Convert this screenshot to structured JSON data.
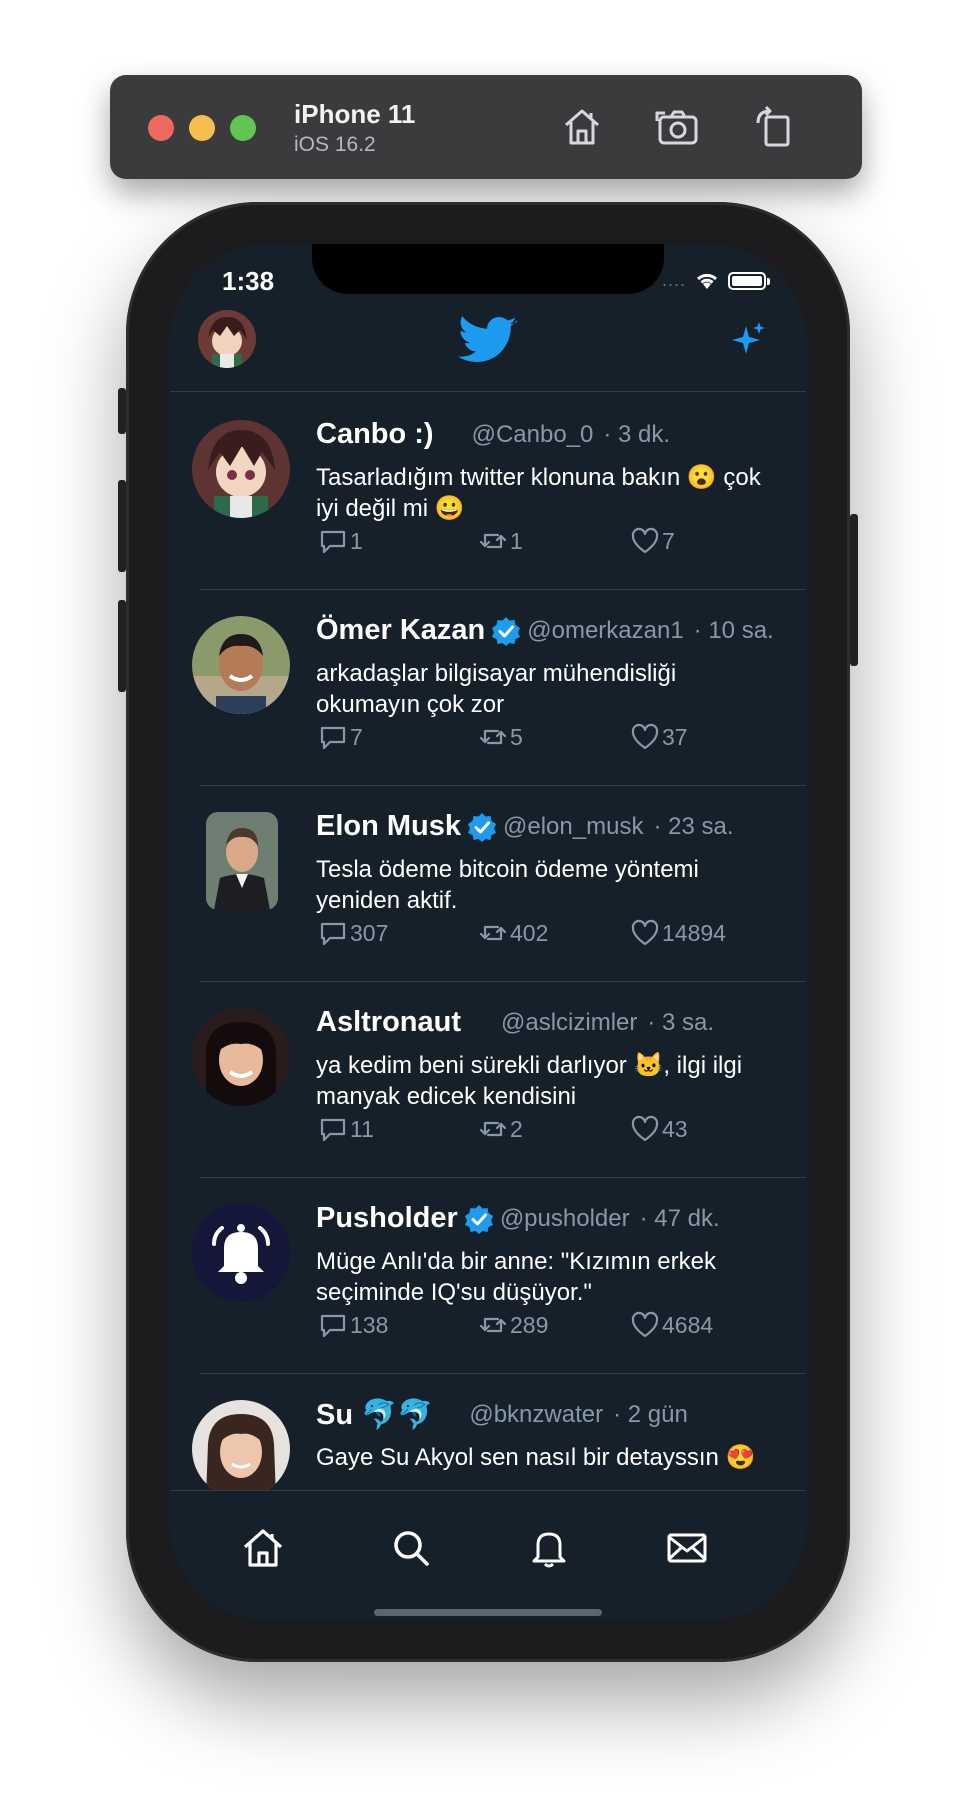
{
  "simulator": {
    "device_name": "iPhone 11",
    "os_version": "iOS 16.2",
    "buttons": [
      "home-icon",
      "screenshot-icon",
      "rotate-icon"
    ]
  },
  "status_bar": {
    "time": "1:38",
    "signal": "...."
  },
  "header": {
    "logo": "twitter-bird-icon",
    "right_icon": "sparkle-icon"
  },
  "colors": {
    "background": "#15202b",
    "accent": "#1d9bf0",
    "muted": "#8899a6",
    "divider": "#2f3b47"
  },
  "tweets": [
    {
      "name": "Canbo :)",
      "verified": false,
      "handle": "@Canbo_0",
      "time": "· 3 dk.",
      "text": "Tasarladığım twitter klonuna bakın 😮 çok iyi değil mi 😀",
      "replies": "1",
      "retweets": "1",
      "likes": "7"
    },
    {
      "name": "Ömer Kazan",
      "verified": true,
      "handle": "@omerkazan1",
      "time": "· 10 sa.",
      "text": "arkadaşlar bilgisayar mühendisliği okumayın çok zor",
      "replies": "7",
      "retweets": "5",
      "likes": "37"
    },
    {
      "name": "Elon Musk",
      "verified": true,
      "handle": "@elon_musk",
      "time": "· 23 sa.",
      "text": "Tesla ödeme bitcoin ödeme yöntemi yeniden aktif.",
      "replies": "307",
      "retweets": "402",
      "likes": "14894"
    },
    {
      "name": "Asltronaut",
      "verified": false,
      "handle": "@aslcizimler",
      "time": "· 3 sa.",
      "text": "ya kedim beni sürekli darlıyor 🐱, ilgi ilgi manyak edicek kendisini",
      "replies": "11",
      "retweets": "2",
      "likes": "43"
    },
    {
      "name": "Pusholder",
      "verified": true,
      "handle": "@pusholder",
      "time": "· 47 dk.",
      "text": "Müge Anlı'da bir anne: \"Kızımın erkek seçiminde IQ'su düşüyor.\"",
      "replies": "138",
      "retweets": "289",
      "likes": "4684"
    },
    {
      "name": "Su 🐬🐬",
      "verified": false,
      "handle": "@bknzwater",
      "time": "· 2 gün",
      "text": "Gaye Su Akyol sen nasıl bir detayssın 😍",
      "replies": "",
      "retweets": "",
      "likes": ""
    }
  ],
  "tabbar": {
    "items": [
      "home-icon",
      "search-icon",
      "bell-icon",
      "mail-icon"
    ]
  }
}
